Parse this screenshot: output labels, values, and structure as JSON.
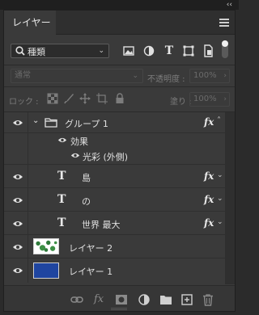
{
  "window": {
    "collapse_glyph": "‹‹"
  },
  "tab": {
    "label": "レイヤー"
  },
  "filter": {
    "kind_label": "種類"
  },
  "blend": {
    "mode": "通常",
    "opacity_label": "不透明度 :",
    "opacity": "100%"
  },
  "lock": {
    "label": "ロック :",
    "fill_label": "塗り :",
    "fill": "100%"
  },
  "layers": [
    {
      "name": "グループ 1",
      "type": "group",
      "fx": true
    },
    {
      "name": "効果",
      "type": "effects-header"
    },
    {
      "name": "光彩 (外側)",
      "type": "effect"
    },
    {
      "name": "島",
      "type": "text",
      "fx": true
    },
    {
      "name": "の",
      "type": "text",
      "fx": true
    },
    {
      "name": "世界 最大",
      "type": "text",
      "fx": true
    },
    {
      "name": "レイヤー 2",
      "type": "pixel",
      "thumb_color": "#ffffff"
    },
    {
      "name": "レイヤー 1",
      "type": "pixel",
      "thumb_color": "#1f45a0"
    }
  ],
  "fx_symbol": "fx",
  "type_symbol": "T"
}
